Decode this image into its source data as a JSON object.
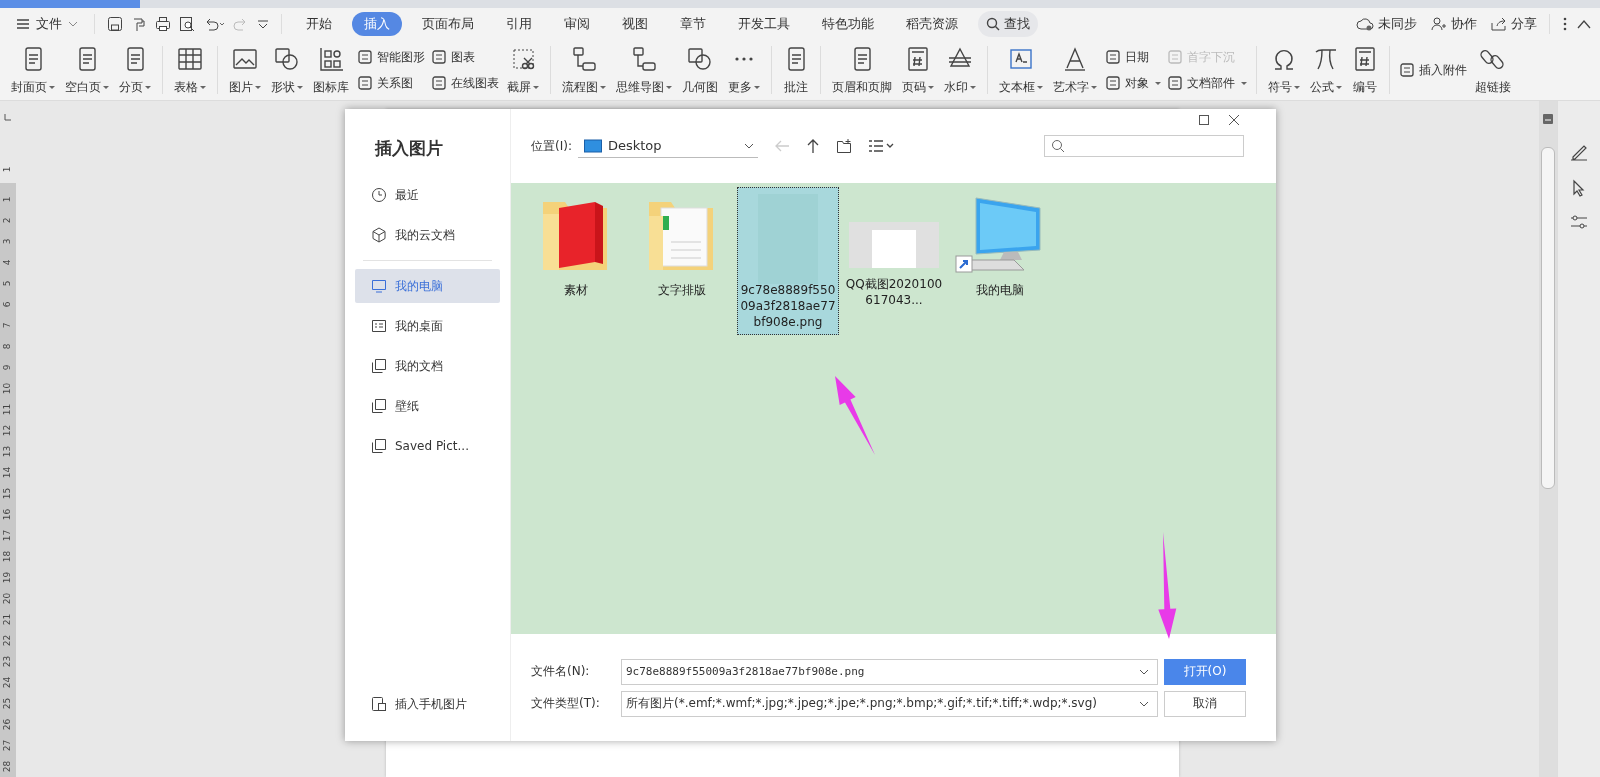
{
  "menu": {
    "label": "文件"
  },
  "tabs": [
    {
      "label": "开始",
      "selected": false
    },
    {
      "label": "插入",
      "selected": true
    },
    {
      "label": "页面布局",
      "selected": false
    },
    {
      "label": "引用",
      "selected": false
    },
    {
      "label": "审阅",
      "selected": false
    },
    {
      "label": "视图",
      "selected": false
    },
    {
      "label": "章节",
      "selected": false
    },
    {
      "label": "开发工具",
      "selected": false
    },
    {
      "label": "特色功能",
      "selected": false
    },
    {
      "label": "稻壳资源",
      "selected": false
    }
  ],
  "search": {
    "label": "查找"
  },
  "top_actions": [
    {
      "label": "未同步"
    },
    {
      "label": "协作"
    },
    {
      "label": "分享"
    }
  ],
  "ribbon": {
    "groups": [
      [
        {
          "kind": "large",
          "label": "封面页",
          "dropdown": true
        },
        {
          "kind": "large",
          "label": "空白页",
          "dropdown": true
        },
        {
          "kind": "large",
          "label": "分页",
          "dropdown": true
        }
      ],
      [
        {
          "kind": "large",
          "label": "表格",
          "dropdown": true
        }
      ],
      [
        {
          "kind": "large",
          "label": "图片",
          "dropdown": true
        },
        {
          "kind": "large",
          "label": "形状",
          "dropdown": true
        },
        {
          "kind": "large",
          "label": "图标库",
          "dropdown": false
        },
        {
          "kind": "stack",
          "items": [
            {
              "label": "智能图形",
              "dropdown": false,
              "disabled": false
            },
            {
              "label": "关系图",
              "dropdown": false,
              "disabled": false
            }
          ]
        },
        {
          "kind": "stack",
          "items": [
            {
              "label": "图表",
              "dropdown": false,
              "disabled": false
            },
            {
              "label": "在线图表",
              "dropdown": false,
              "disabled": false
            }
          ]
        },
        {
          "kind": "large",
          "label": "截屏",
          "dropdown": true
        }
      ],
      [
        {
          "kind": "large",
          "label": "流程图",
          "dropdown": true
        },
        {
          "kind": "large",
          "label": "思维导图",
          "dropdown": true
        },
        {
          "kind": "large",
          "label": "几何图",
          "dropdown": false
        },
        {
          "kind": "large",
          "label": "更多",
          "dropdown": true
        }
      ],
      [
        {
          "kind": "large",
          "label": "批注",
          "dropdown": false
        }
      ],
      [
        {
          "kind": "large",
          "label": "页眉和页脚",
          "dropdown": false
        },
        {
          "kind": "large",
          "label": "页码",
          "dropdown": true
        },
        {
          "kind": "large",
          "label": "水印",
          "dropdown": true
        }
      ],
      [
        {
          "kind": "large",
          "label": "文本框",
          "dropdown": true
        },
        {
          "kind": "large",
          "label": "艺术字",
          "dropdown": true
        },
        {
          "kind": "stack",
          "items": [
            {
              "label": "日期",
              "dropdown": false,
              "disabled": false
            },
            {
              "label": "对象",
              "dropdown": true,
              "disabled": false
            }
          ]
        },
        {
          "kind": "stack",
          "items": [
            {
              "label": "首字下沉",
              "dropdown": false,
              "disabled": true
            },
            {
              "label": "文档部件",
              "dropdown": true,
              "disabled": false
            }
          ]
        }
      ],
      [
        {
          "kind": "large",
          "label": "符号",
          "dropdown": true
        },
        {
          "kind": "large",
          "label": "公式",
          "dropdown": true
        },
        {
          "kind": "large",
          "label": "编号",
          "dropdown": false
        }
      ],
      [
        {
          "kind": "stack",
          "items": [
            {
              "label": "插入附件",
              "dropdown": false,
              "disabled": false
            }
          ]
        },
        {
          "kind": "large",
          "label": "超链接",
          "dropdown": false
        }
      ]
    ]
  },
  "ruler": {
    "top_mark": "1",
    "marks": [
      "1",
      "2",
      "3",
      "4",
      "5",
      "6",
      "7",
      "8",
      "9",
      "10",
      "11",
      "12",
      "13",
      "14",
      "15",
      "16",
      "17",
      "18",
      "19",
      "20",
      "21",
      "22",
      "23",
      "24",
      "25",
      "26",
      "27",
      "28"
    ]
  },
  "dialog": {
    "title": "插入图片",
    "nav": [
      {
        "label": "最近",
        "selected": false
      },
      {
        "label": "我的云文档",
        "selected": false
      },
      {
        "label": "我的电脑",
        "selected": true
      },
      {
        "label": "我的桌面",
        "selected": false
      },
      {
        "label": "我的文档",
        "selected": false
      },
      {
        "label": "壁纸",
        "selected": false
      },
      {
        "label": "Saved Pict...",
        "selected": false
      }
    ],
    "phone_import": "插入手机图片",
    "location_label": "位置(I):",
    "location": "Desktop",
    "files": [
      {
        "name": "素材",
        "kind": "book-folder",
        "selected": false
      },
      {
        "name": "文字排版",
        "kind": "doc-folder",
        "selected": false
      },
      {
        "name": "9c78e8889f55009a3f2818ae77bf908e.png",
        "kind": "image",
        "selected": true
      },
      {
        "name": "QQ截图2020100617043...",
        "kind": "screenshot",
        "selected": false
      },
      {
        "name": "我的电脑",
        "kind": "computer",
        "selected": false
      }
    ],
    "filename_label": "文件名(N):",
    "filename": "9c78e8889f55009a3f2818ae77bf908e.png",
    "filetype_label": "文件类型(T):",
    "filetype": "所有图片(*.emf;*.wmf;*.jpg;*.jpeg;*.jpe;*.png;*.bmp;*.gif;*.tif;*.tiff;*.wdp;*.svg)",
    "open_button": "打开(O)",
    "cancel_button": "取消"
  }
}
